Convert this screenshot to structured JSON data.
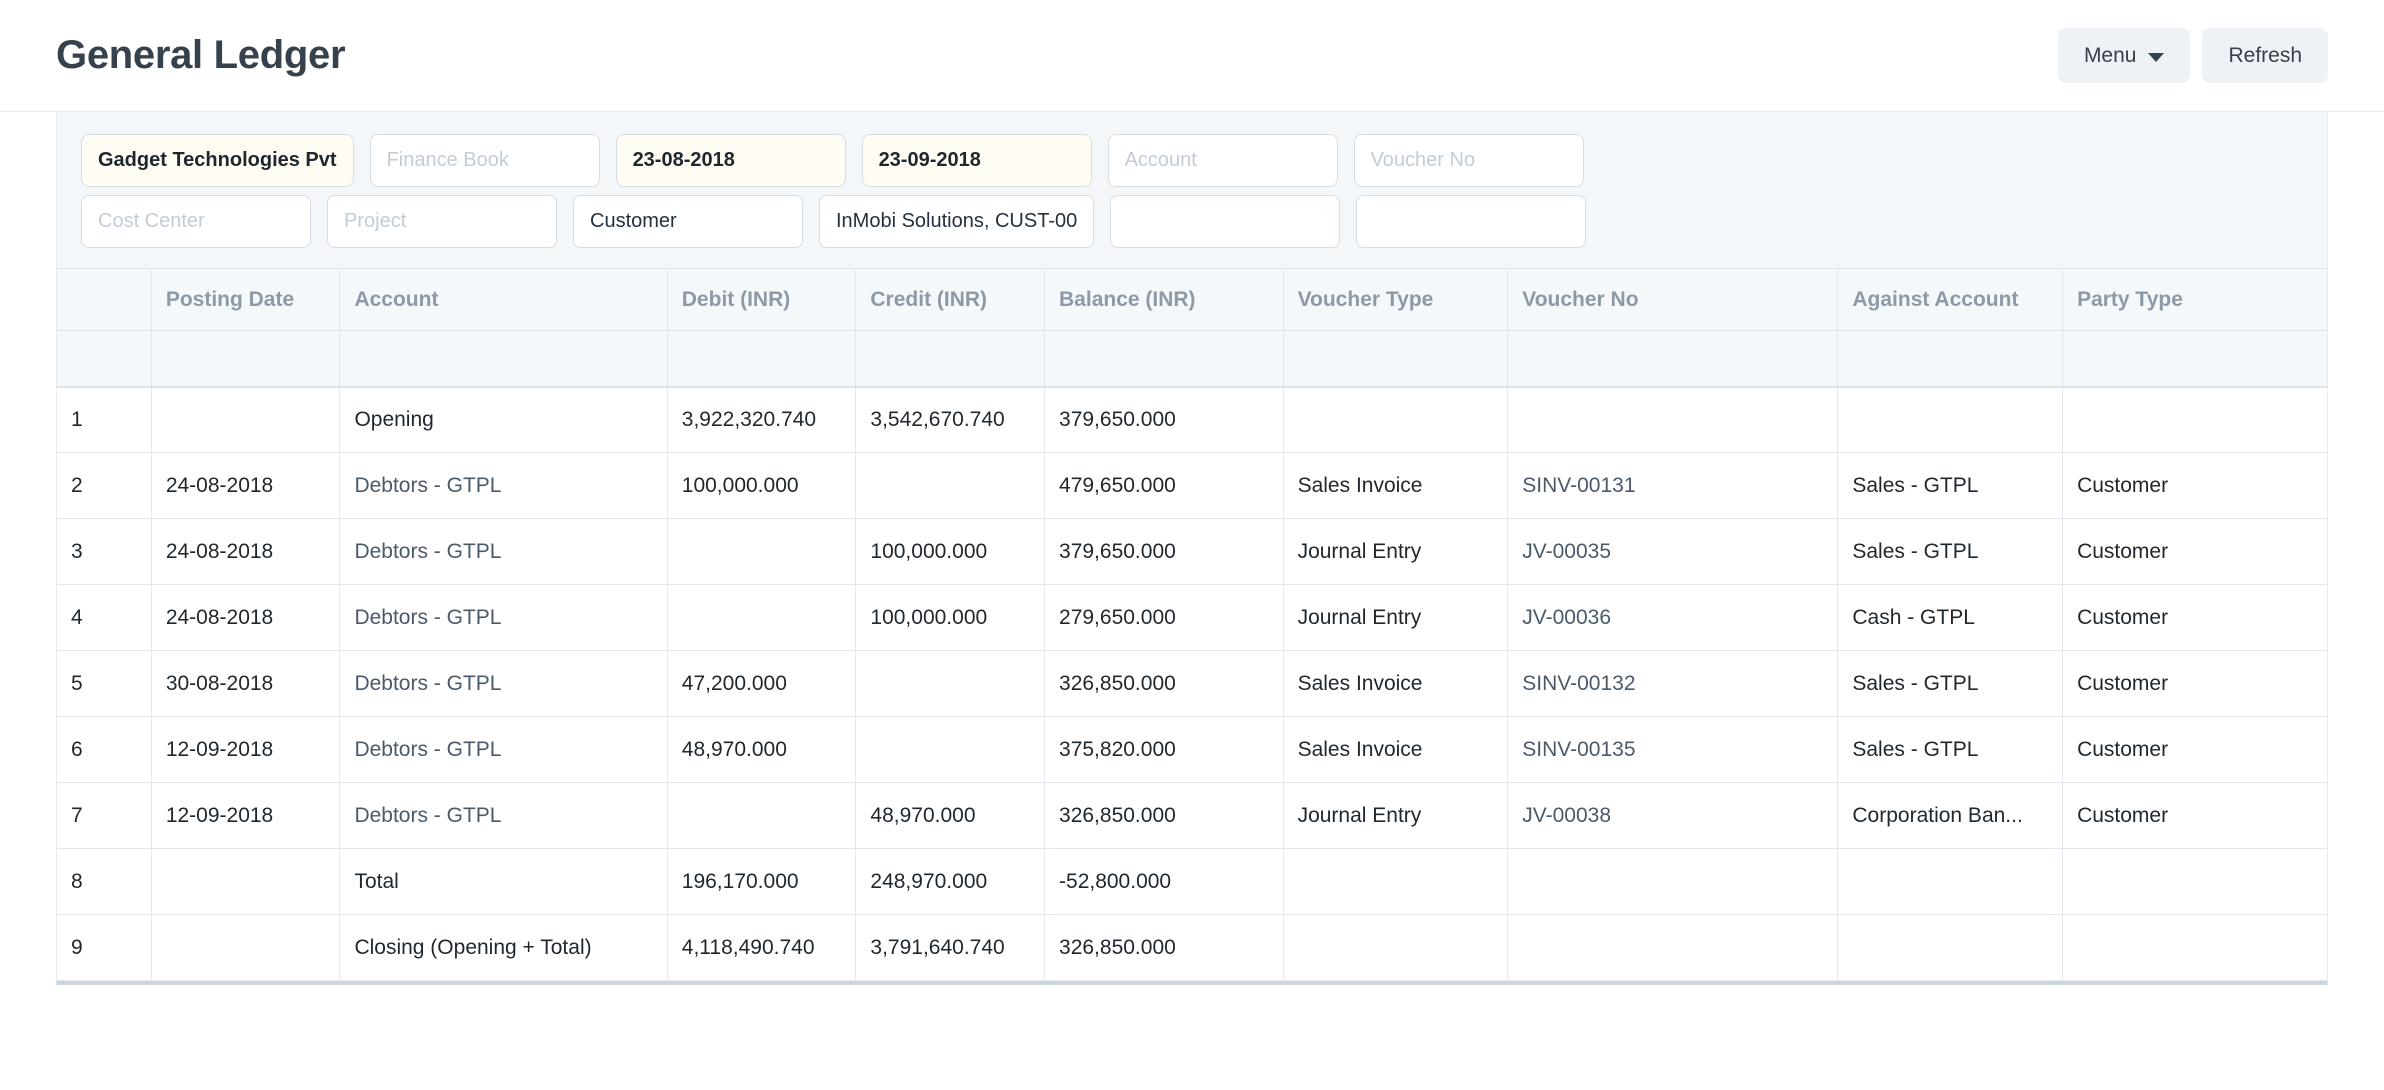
{
  "header": {
    "title": "General Ledger",
    "menu_label": "Menu",
    "refresh_label": "Refresh"
  },
  "filters": {
    "row1": [
      {
        "name": "company",
        "value": "Gadget Technologies Pvt",
        "placeholder": "Company",
        "state": "modified"
      },
      {
        "name": "finance-book",
        "value": "",
        "placeholder": "Finance Book",
        "state": "placeholder"
      },
      {
        "name": "from-date",
        "value": "23-08-2018",
        "placeholder": "From Date",
        "state": "modified"
      },
      {
        "name": "to-date",
        "value": "23-09-2018",
        "placeholder": "To Date",
        "state": "modified"
      },
      {
        "name": "account",
        "value": "",
        "placeholder": "Account",
        "state": "placeholder"
      },
      {
        "name": "voucher-no",
        "value": "",
        "placeholder": "Voucher No",
        "state": "placeholder"
      }
    ],
    "row2": [
      {
        "name": "cost-center",
        "value": "",
        "placeholder": "Cost Center",
        "state": "placeholder"
      },
      {
        "name": "project",
        "value": "",
        "placeholder": "Project",
        "state": "placeholder"
      },
      {
        "name": "party-type",
        "value": "Customer",
        "placeholder": "Party Type",
        "state": "filled"
      },
      {
        "name": "party",
        "value": "InMobi Solutions, CUST-00",
        "placeholder": "Party",
        "state": "filled"
      },
      {
        "name": "filter-extra-1",
        "value": "",
        "placeholder": "",
        "state": "blank"
      },
      {
        "name": "filter-extra-2",
        "value": "",
        "placeholder": "",
        "state": "blank"
      }
    ]
  },
  "table": {
    "columns": [
      {
        "key": "idx",
        "label": "",
        "align": "center",
        "cls": "c-idx"
      },
      {
        "key": "date",
        "label": "Posting Date",
        "align": "left",
        "cls": "c-date"
      },
      {
        "key": "acct",
        "label": "Account",
        "align": "left",
        "cls": "c-acct"
      },
      {
        "key": "debit",
        "label": "Debit (INR)",
        "align": "right",
        "cls": "c-debit"
      },
      {
        "key": "credit",
        "label": "Credit (INR)",
        "align": "right",
        "cls": "c-credit"
      },
      {
        "key": "bal",
        "label": "Balance (INR)",
        "align": "right",
        "cls": "c-bal"
      },
      {
        "key": "vtype",
        "label": "Voucher Type",
        "align": "left",
        "cls": "c-vtype"
      },
      {
        "key": "vno",
        "label": "Voucher No",
        "align": "left",
        "cls": "c-vno"
      },
      {
        "key": "again",
        "label": "Against Account",
        "align": "left",
        "cls": "c-again"
      },
      {
        "key": "party",
        "label": "Party Type",
        "align": "left",
        "cls": "c-party"
      },
      {
        "key": "pad",
        "label": "",
        "align": "left",
        "cls": "c-pad"
      }
    ],
    "rows": [
      {
        "idx": "1",
        "date": "",
        "acct": "Opening",
        "acct_link": false,
        "debit": "3,922,320.740",
        "credit": "3,542,670.740",
        "bal": "379,650.000",
        "vtype": "",
        "vno": "",
        "again": "",
        "party": ""
      },
      {
        "idx": "2",
        "date": "24-08-2018",
        "acct": "Debtors - GTPL",
        "acct_link": true,
        "debit": "100,000.000",
        "credit": "",
        "bal": "479,650.000",
        "vtype": "Sales Invoice",
        "vno": "SINV-00131",
        "again": "Sales - GTPL",
        "party": "Customer"
      },
      {
        "idx": "3",
        "date": "24-08-2018",
        "acct": "Debtors - GTPL",
        "acct_link": true,
        "debit": "",
        "credit": "100,000.000",
        "bal": "379,650.000",
        "vtype": "Journal Entry",
        "vno": "JV-00035",
        "again": "Sales - GTPL",
        "party": "Customer"
      },
      {
        "idx": "4",
        "date": "24-08-2018",
        "acct": "Debtors - GTPL",
        "acct_link": true,
        "debit": "",
        "credit": "100,000.000",
        "bal": "279,650.000",
        "vtype": "Journal Entry",
        "vno": "JV-00036",
        "again": "Cash - GTPL",
        "party": "Customer"
      },
      {
        "idx": "5",
        "date": "30-08-2018",
        "acct": "Debtors - GTPL",
        "acct_link": true,
        "debit": "47,200.000",
        "credit": "",
        "bal": "326,850.000",
        "vtype": "Sales Invoice",
        "vno": "SINV-00132",
        "again": "Sales - GTPL",
        "party": "Customer"
      },
      {
        "idx": "6",
        "date": "12-09-2018",
        "acct": "Debtors - GTPL",
        "acct_link": true,
        "debit": "48,970.000",
        "credit": "",
        "bal": "375,820.000",
        "vtype": "Sales Invoice",
        "vno": "SINV-00135",
        "again": "Sales - GTPL",
        "party": "Customer"
      },
      {
        "idx": "7",
        "date": "12-09-2018",
        "acct": "Debtors - GTPL",
        "acct_link": true,
        "debit": "",
        "credit": "48,970.000",
        "bal": "326,850.000",
        "vtype": "Journal Entry",
        "vno": "JV-00038",
        "again": "Corporation Ban...",
        "party": "Customer"
      },
      {
        "idx": "8",
        "date": "",
        "acct": "Total",
        "acct_link": false,
        "debit": "196,170.000",
        "credit": "248,970.000",
        "bal": "-52,800.000",
        "vtype": "",
        "vno": "",
        "again": "",
        "party": ""
      },
      {
        "idx": "9",
        "date": "",
        "acct": "Closing (Opening + Total)",
        "acct_link": false,
        "debit": "4,118,490.740",
        "credit": "3,791,640.740",
        "bal": "326,850.000",
        "vtype": "",
        "vno": "",
        "again": "",
        "party": ""
      }
    ]
  },
  "colors": {
    "title": "#36414c",
    "link": "#4a5a6b",
    "header_text": "#8d99a6",
    "modified_bg": "#fffdf3",
    "filter_bg": "#f4f7fa"
  }
}
